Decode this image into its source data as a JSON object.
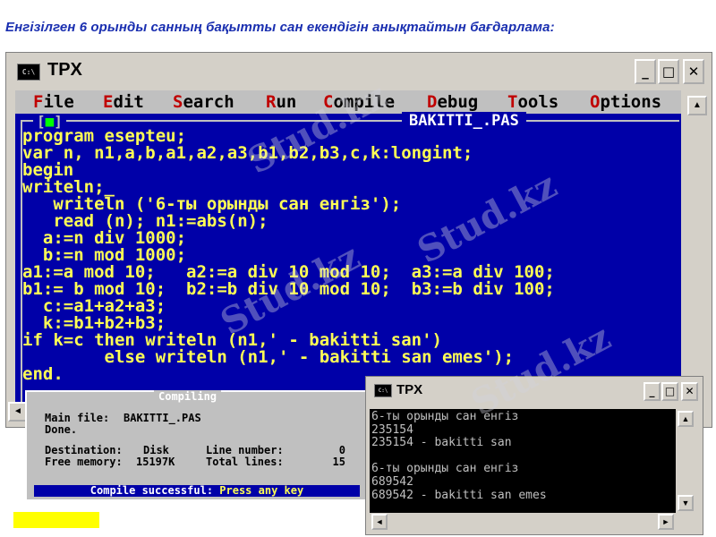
{
  "slide_title": "Енгізілген 6 орынды санның бақытты сан екендігін анықтайтын бағдарлама:",
  "main_window": {
    "title": "TPX",
    "icon_text": "C:\\",
    "controls": {
      "minimize": "_",
      "maximize": "□",
      "close": "✕"
    },
    "menu": [
      {
        "hotkey": "F",
        "rest": "ile"
      },
      {
        "hotkey": "E",
        "rest": "dit"
      },
      {
        "hotkey": "S",
        "rest": "earch"
      },
      {
        "hotkey": "R",
        "rest": "un"
      },
      {
        "hotkey": "C",
        "rest": "ompile"
      },
      {
        "hotkey": "D",
        "rest": "ebug"
      },
      {
        "hotkey": "T",
        "rest": "ools"
      },
      {
        "hotkey": "O",
        "rest": "ptions"
      }
    ],
    "editor_frame": {
      "close_box": "[",
      "close_mark": "■",
      "close_end": "]",
      "filename": "BAKITTI_.PAS"
    },
    "code_lines": [
      "program esepteu;",
      "var n, n1,a,b,a1,a2,a3,b1,b2,b3,c,k:longint;",
      "begin",
      "writeln;_",
      "   writeln ('6-ты орынды сан енгіз');",
      "   read (n); n1:=abs(n);",
      "  a:=n div 1000;",
      "  b:=n mod 1000;",
      "a1:=a mod 10;   a2:=a div 10 mod 10;  a3:=a div 100;",
      "b1:= b mod 10;  b2:=b div 10 mod 10;  b3:=b div 100;",
      "  c:=a1+a2+a3;",
      "  k:=b1+b2+b3;",
      "if k=c then writeln (n1,' - bakitti san')",
      "        else writeln (n1,' - bakitti san emes');",
      "end."
    ]
  },
  "compile_dialog": {
    "title": "Compiling",
    "main_file_label": "Main file:",
    "main_file_value": "BAKITTI_.PAS",
    "done_text": "Done.",
    "destination_label": "Destination:",
    "destination_value": "Disk",
    "line_number_label": "Line number:",
    "line_number_value": "0",
    "free_memory_label": "Free memory:",
    "free_memory_value": "15197K",
    "total_lines_label": "Total lines:",
    "total_lines_value": "15",
    "status_prefix": "Compile successful: ",
    "status_hot": "Press any key"
  },
  "output_window": {
    "title": "TPX",
    "icon_text": "C:\\",
    "controls": {
      "minimize": "_",
      "maximize": "□",
      "close": "✕"
    },
    "console_lines": [
      "6-ты орынды сан енгіз",
      "235154",
      "235154 - bakitti san",
      "",
      "6-ты орынды сан енгіз",
      "689542",
      "689542 - bakitti san emes"
    ]
  },
  "watermark": "Stud.kz",
  "icons": {
    "scroll_up": "▲",
    "scroll_down": "▼",
    "scroll_left": "◄",
    "scroll_right": "►"
  }
}
